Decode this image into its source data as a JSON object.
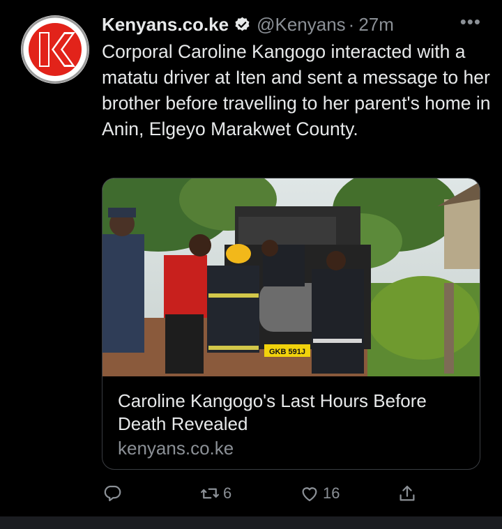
{
  "tweet": {
    "author_name": "Kenyans.co.ke",
    "handle": "@Kenyans",
    "separator": "·",
    "time": "27m",
    "more_label": "•••",
    "text": "Corporal Caroline Kangogo interacted with a matatu driver at Iten and sent a message to her brother before travelling to her parent's home in Anin, Elgeyo Marakwet County."
  },
  "card": {
    "title": "Caroline Kangogo's Last Hours Before Death Revealed",
    "domain": "kenyans.co.ke",
    "plate": "GKB 591J"
  },
  "actions": {
    "retweet_count": "6",
    "like_count": "16"
  },
  "colors": {
    "background": "#000000",
    "text": "#e7e9ea",
    "secondary": "#8b9096",
    "border": "#3a3d42",
    "brand_red": "#e2231a"
  },
  "icons": [
    "kenyans-logo-icon",
    "verified-badge-icon",
    "more-options-icon",
    "reply-icon",
    "retweet-icon",
    "like-icon",
    "share-icon"
  ]
}
